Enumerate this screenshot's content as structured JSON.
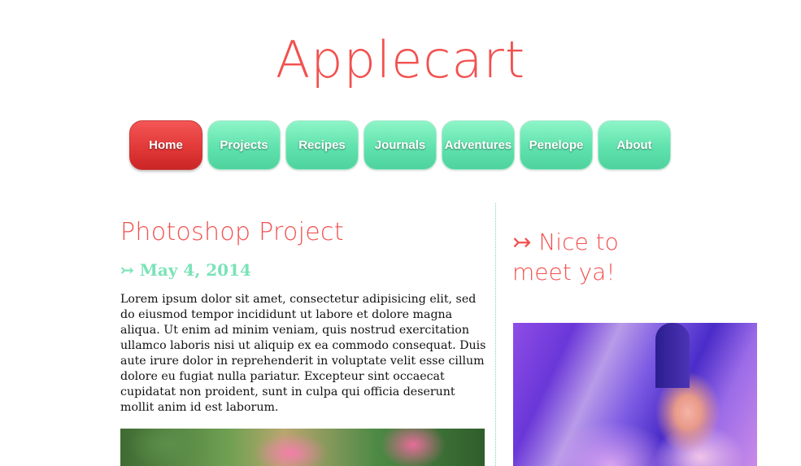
{
  "site": {
    "title": "Applecart"
  },
  "nav": {
    "items": [
      {
        "label": "Home",
        "active": true
      },
      {
        "label": "Projects"
      },
      {
        "label": "Recipes"
      },
      {
        "label": "Journals"
      },
      {
        "label": "Adventures"
      },
      {
        "label": "Penelope"
      },
      {
        "label": "About"
      }
    ],
    "colors": {
      "active": "#e03636",
      "inactive": "#5fe2ad"
    }
  },
  "post": {
    "title": "Photoshop Project",
    "date": "↣ May 4, 2014",
    "body": "Lorem ipsum dolor sit amet, consectetur adipisicing elit, sed do eiusmod tempor incididunt ut labore et dolore magna aliqua. Ut enim ad minim veniam, quis nostrud exercitation ullamco laboris nisi ut aliquip ex ea commodo consequat. Duis aute irure dolor in reprehenderit in voluptate velit esse cillum dolore eu fugiat nulla pariatur. Excepteur sint occaecat cupidatat non proident, sunt in culpa qui officia deserunt mollit anim id est laborum."
  },
  "sidebar": {
    "title": "↣ Nice to meet ya!"
  },
  "colors": {
    "accent": "#f2514f",
    "mint": "#7ae3b8"
  }
}
